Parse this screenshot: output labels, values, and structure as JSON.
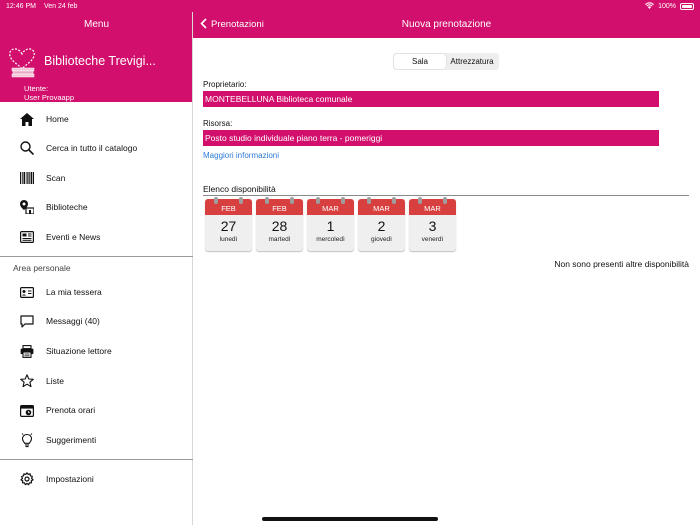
{
  "status": {
    "time": "12:46 PM",
    "date": "Ven 24 feb",
    "battery": "100%"
  },
  "sidebar": {
    "title": "Menu",
    "library_name": "Biblioteche Trevigi...",
    "user_label": "Utente:",
    "user_name": "User Provaapp",
    "items": [
      {
        "label": "Home",
        "icon": "home-icon"
      },
      {
        "label": "Cerca in tutto il catalogo",
        "icon": "search-icon"
      },
      {
        "label": "Scan",
        "icon": "barcode-icon"
      },
      {
        "label": "Biblioteche",
        "icon": "library-location-icon"
      },
      {
        "label": "Eventi e News",
        "icon": "news-icon"
      }
    ],
    "section_label": "Area personale",
    "personal_items": [
      {
        "label": "La mia tessera",
        "icon": "id-card-icon"
      },
      {
        "label": "Messaggi (40)",
        "icon": "message-icon"
      },
      {
        "label": "Situazione lettore",
        "icon": "printer-icon"
      },
      {
        "label": "Liste",
        "icon": "star-icon"
      },
      {
        "label": "Prenota orari",
        "icon": "calendar-clock-icon"
      },
      {
        "label": "Suggerimenti",
        "icon": "lightbulb-icon"
      }
    ],
    "settings": {
      "label": "Impostazioni",
      "icon": "gear-icon"
    }
  },
  "topbar": {
    "back_label": "Prenotazioni",
    "title": "Nuova prenotazione"
  },
  "segmented": {
    "options": [
      "Sala",
      "Attrezzatura"
    ],
    "selected": "Sala"
  },
  "form": {
    "owner_label": "Proprietario:",
    "owner_value": "MONTEBELLUNA Biblioteca comunale",
    "resource_label": "Risorsa:",
    "resource_value": "Posto studio individuale piano terra - pomeriggi",
    "more_info": "Maggiori informazioni"
  },
  "availability": {
    "title": "Elenco disponibilità",
    "days": [
      {
        "month": "FEB",
        "day": "27",
        "weekday": "lunedì"
      },
      {
        "month": "FEB",
        "day": "28",
        "weekday": "martedì"
      },
      {
        "month": "MAR",
        "day": "1",
        "weekday": "mercoledì"
      },
      {
        "month": "MAR",
        "day": "2",
        "weekday": "giovedì"
      },
      {
        "month": "MAR",
        "day": "3",
        "weekday": "venerdì"
      }
    ],
    "no_more": "Non sono presenti altre disponibilità"
  },
  "colors": {
    "brand": "#d20f6c",
    "calendar_red": "#d84040",
    "link": "#2b7bd6"
  }
}
